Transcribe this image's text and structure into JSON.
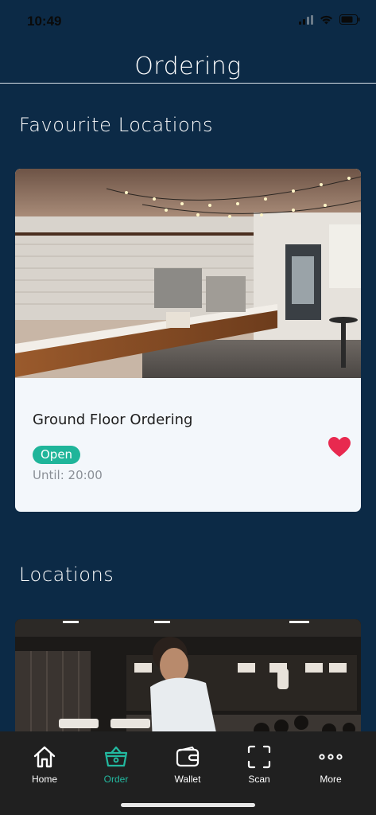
{
  "status_bar": {
    "time": "10:49"
  },
  "header": {
    "title": "Ordering"
  },
  "favourites": {
    "section_title": "Favourite Locations",
    "card": {
      "name": "Ground Floor Ordering",
      "status": "Open",
      "hours": "Until: 20:00",
      "favourite_icon": "heart-icon",
      "favourited": true
    }
  },
  "locations": {
    "section_title": "Locations"
  },
  "tab_bar": {
    "active": "Order",
    "tabs": [
      {
        "label": "Home",
        "icon": "home-icon"
      },
      {
        "label": "Order",
        "icon": "basket-icon"
      },
      {
        "label": "Wallet",
        "icon": "wallet-icon"
      },
      {
        "label": "Scan",
        "icon": "scan-icon"
      },
      {
        "label": "More",
        "icon": "more-icon"
      }
    ]
  },
  "colors": {
    "background": "#0c2a46",
    "accent": "#1fb59a",
    "heart": "#e8294f",
    "tab_bar": "#202020"
  }
}
